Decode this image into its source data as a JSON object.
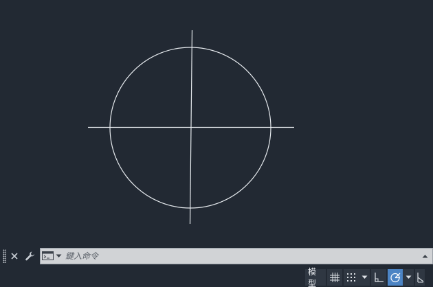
{
  "colors": {
    "background": "#222933",
    "drawing_stroke": "#e8ecf0",
    "command_bar_bg": "#d1d3d6",
    "status_active": "#4c84c4"
  },
  "drawing": {
    "entities": [
      "circle",
      "horizontal-line",
      "vertical-line"
    ]
  },
  "command_line": {
    "close_icon": "close-icon",
    "customize_icon": "wrench-icon",
    "prompt_icon": "command-prompt-icon",
    "input_placeholder": "鍵入命令",
    "input_value": "",
    "history_icon": "triangle-up-icon"
  },
  "status_bar": {
    "model_label": "模型",
    "grid_icon": "grid-icon",
    "snap_icon": "snap-dots-icon",
    "snap_menu_icon": "caret-down-icon",
    "ortho_icon": "ortho-icon",
    "polar_icon": "polar-tracking-icon",
    "polar_menu_icon": "caret-down-icon",
    "isodraft_icon": "isodraft-icon"
  }
}
